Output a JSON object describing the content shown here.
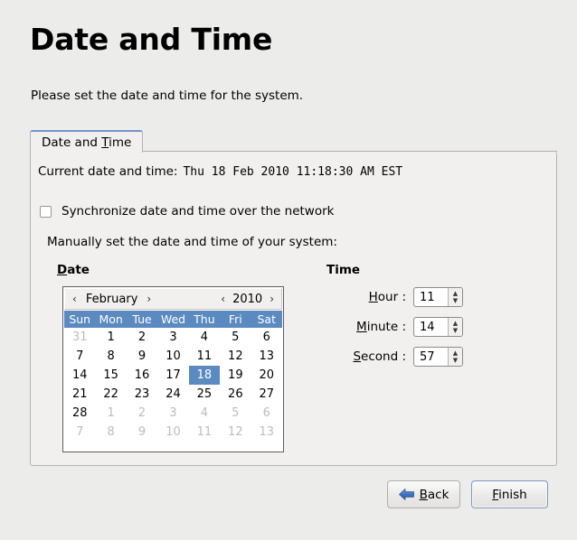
{
  "page": {
    "title": "Date and Time",
    "subtitle": "Please set the date and time for the system."
  },
  "tabs": [
    {
      "label": "Date and Time",
      "mnemonic": "T",
      "active": true
    }
  ],
  "panel": {
    "current_label": "Current date and time:",
    "current_value": "Thu 18 Feb 2010 11:18:30 AM EST",
    "sync_checkbox": {
      "label": "Synchronize date and time over the network",
      "checked": false
    },
    "manual_label": "Manually set the date and time of your system:"
  },
  "date_section": {
    "heading": "Date",
    "heading_mnemonic": "D",
    "calendar": {
      "month": "February",
      "year": "2010",
      "prev_month_icon": "‹",
      "next_month_icon": "›",
      "prev_year_icon": "‹",
      "next_year_icon": "›",
      "weekdays": [
        "Sun",
        "Mon",
        "Tue",
        "Wed",
        "Thu",
        "Fri",
        "Sat"
      ],
      "selected_day": 18,
      "weeks": [
        [
          {
            "d": "31",
            "dim": true
          },
          {
            "d": "1",
            "dim": false
          },
          {
            "d": "2",
            "dim": false
          },
          {
            "d": "3",
            "dim": false
          },
          {
            "d": "4",
            "dim": false
          },
          {
            "d": "5",
            "dim": false
          },
          {
            "d": "6",
            "dim": false
          }
        ],
        [
          {
            "d": "7",
            "dim": false
          },
          {
            "d": "8",
            "dim": false
          },
          {
            "d": "9",
            "dim": false
          },
          {
            "d": "10",
            "dim": false
          },
          {
            "d": "11",
            "dim": false
          },
          {
            "d": "12",
            "dim": false
          },
          {
            "d": "13",
            "dim": false
          }
        ],
        [
          {
            "d": "14",
            "dim": false
          },
          {
            "d": "15",
            "dim": false
          },
          {
            "d": "16",
            "dim": false
          },
          {
            "d": "17",
            "dim": false
          },
          {
            "d": "18",
            "dim": false,
            "selected": true
          },
          {
            "d": "19",
            "dim": false
          },
          {
            "d": "20",
            "dim": false
          }
        ],
        [
          {
            "d": "21",
            "dim": false
          },
          {
            "d": "22",
            "dim": false
          },
          {
            "d": "23",
            "dim": false
          },
          {
            "d": "24",
            "dim": false
          },
          {
            "d": "25",
            "dim": false
          },
          {
            "d": "26",
            "dim": false
          },
          {
            "d": "27",
            "dim": false
          }
        ],
        [
          {
            "d": "28",
            "dim": false
          },
          {
            "d": "1",
            "dim": true
          },
          {
            "d": "2",
            "dim": true
          },
          {
            "d": "3",
            "dim": true
          },
          {
            "d": "4",
            "dim": true
          },
          {
            "d": "5",
            "dim": true
          },
          {
            "d": "6",
            "dim": true
          }
        ],
        [
          {
            "d": "7",
            "dim": true
          },
          {
            "d": "8",
            "dim": true
          },
          {
            "d": "9",
            "dim": true
          },
          {
            "d": "10",
            "dim": true
          },
          {
            "d": "11",
            "dim": true
          },
          {
            "d": "12",
            "dim": true
          },
          {
            "d": "13",
            "dim": true
          }
        ]
      ]
    }
  },
  "time_section": {
    "heading": "Time",
    "fields": [
      {
        "label": "Hour :",
        "mnemonic": "H",
        "value": "11"
      },
      {
        "label": "Minute :",
        "mnemonic": "M",
        "value": "14"
      },
      {
        "label": "Second :",
        "mnemonic": "S",
        "value": "57"
      }
    ]
  },
  "footer": {
    "back_label": "Back",
    "back_mnemonic": "B",
    "finish_label": "Finish",
    "finish_mnemonic": "F"
  },
  "colors": {
    "window_bg": "#ececeb",
    "panel_bg": "#f1f0ef",
    "accent_blue": "#5b8ac0",
    "tab_focus_blue": "#7295c4",
    "arrow_blue": "#3f74bd",
    "dim_text": "#bfbdbb"
  }
}
